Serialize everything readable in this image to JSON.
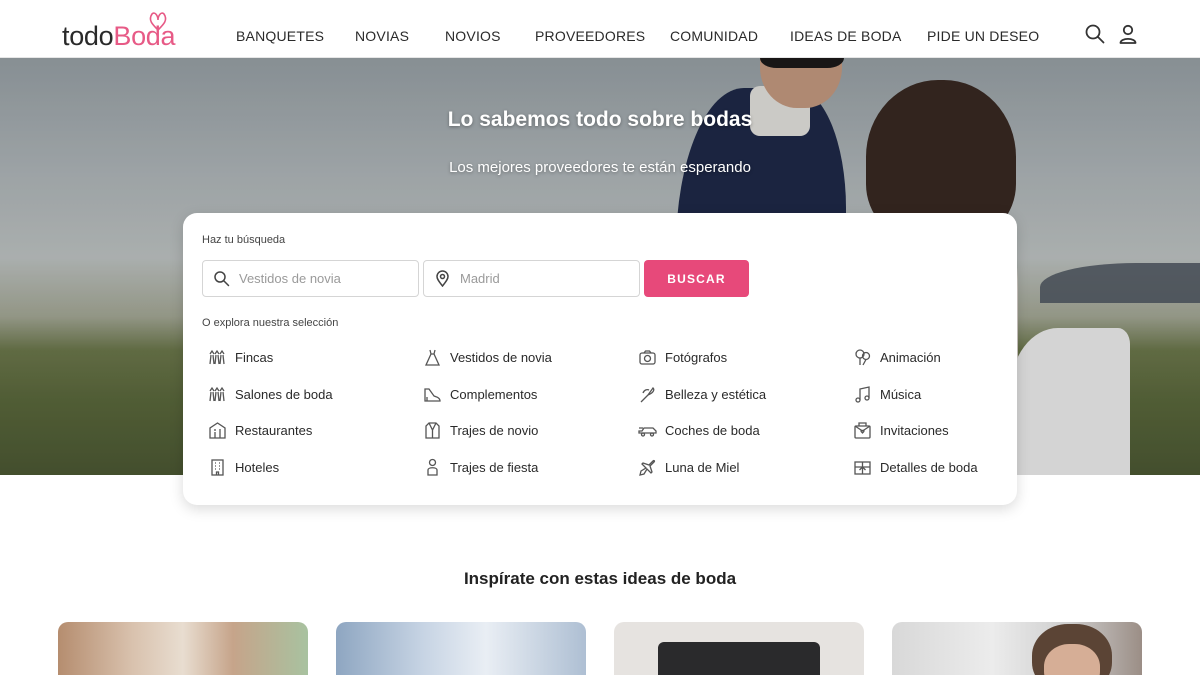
{
  "header": {
    "logo": {
      "part1": "todo",
      "part2": "Boda"
    },
    "nav": [
      "BANQUETES",
      "NOVIAS",
      "NOVIOS",
      "PROVEEDORES",
      "COMUNIDAD",
      "IDEAS DE BODA",
      "PIDE UN DESEO"
    ],
    "icons": [
      "search-icon",
      "user-icon"
    ]
  },
  "hero": {
    "title": "Lo sabemos todo sobre bodas",
    "subtitle": "Los mejores proveedores te están esperando"
  },
  "search": {
    "label": "Haz tu búsqueda",
    "query_placeholder": "Vestidos de novia",
    "location_placeholder": "Madrid",
    "button": "BUSCAR",
    "explore_label": "O explora nuestra selección"
  },
  "categories": [
    {
      "label": "Fincas",
      "icon": "venue-icon"
    },
    {
      "label": "Salones de boda",
      "icon": "venue-icon"
    },
    {
      "label": "Restaurantes",
      "icon": "restaurant-icon"
    },
    {
      "label": "Hoteles",
      "icon": "hotel-icon"
    },
    {
      "label": "Vestidos de novia",
      "icon": "dress-icon"
    },
    {
      "label": "Complementos",
      "icon": "shoe-icon"
    },
    {
      "label": "Trajes de novio",
      "icon": "suit-icon"
    },
    {
      "label": "Trajes de fiesta",
      "icon": "person-icon"
    },
    {
      "label": "Fotógrafos",
      "icon": "camera-icon"
    },
    {
      "label": "Belleza y estética",
      "icon": "beauty-icon"
    },
    {
      "label": "Coches de boda",
      "icon": "car-icon"
    },
    {
      "label": "Luna de Miel",
      "icon": "plane-icon"
    },
    {
      "label": "Animación",
      "icon": "balloon-icon"
    },
    {
      "label": "Música",
      "icon": "music-icon"
    },
    {
      "label": "Invitaciones",
      "icon": "invitation-icon"
    },
    {
      "label": "Detalles de boda",
      "icon": "gift-icon"
    }
  ],
  "inspiration": {
    "title": "Inspírate con estas ideas de boda"
  },
  "colors": {
    "brand_pink": "#e7497a",
    "text_dark": "#2a2a2a"
  }
}
